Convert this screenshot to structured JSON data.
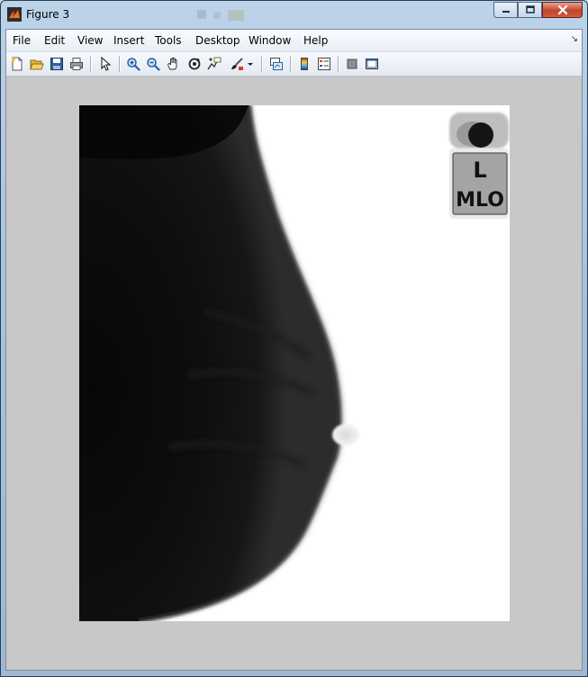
{
  "window": {
    "title": "Figure 3"
  },
  "menu": {
    "items": [
      "File",
      "Edit",
      "View",
      "Insert",
      "Tools",
      "Desktop",
      "Window",
      "Help"
    ]
  },
  "toolbar": {
    "tools": [
      "new-figure-icon",
      "open-file-icon",
      "save-figure-icon",
      "print-figure-icon",
      "edit-plot-icon",
      "zoom-in-icon",
      "zoom-out-icon",
      "pan-icon",
      "rotate-3d-icon",
      "data-cursor-icon",
      "brush-icon",
      "brush-dropdown-icon",
      "link-plot-icon",
      "insert-colorbar-icon",
      "insert-legend-icon",
      "hide-plot-tools-icon",
      "show-plot-tools-icon"
    ]
  },
  "image": {
    "marker_side": "L",
    "marker_view": "MLO"
  }
}
